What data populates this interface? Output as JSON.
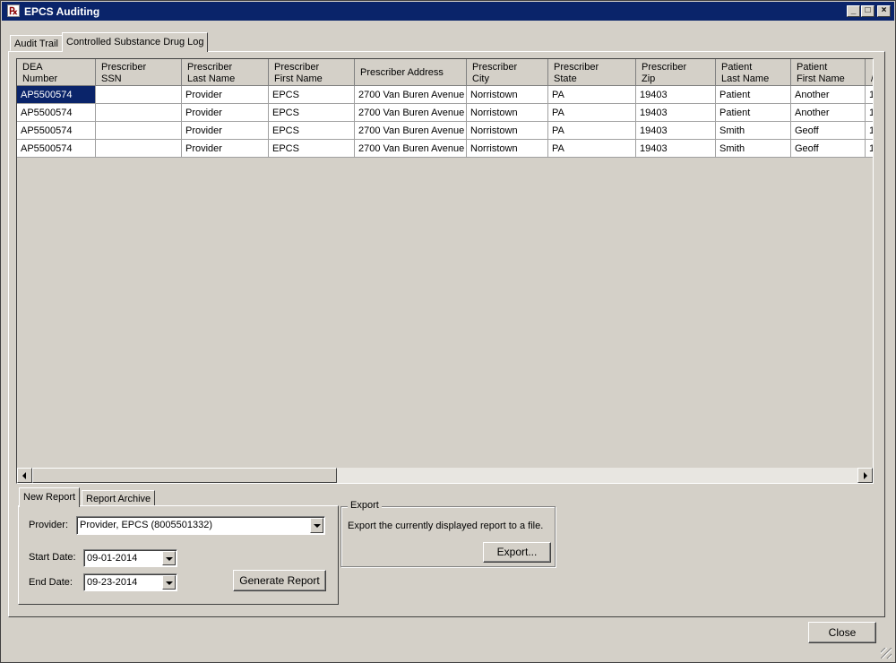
{
  "window": {
    "title": "EPCS Auditing",
    "app_icon": "prescription-icon"
  },
  "title_buttons": {
    "minimize": "_",
    "maximize": "□",
    "close": "×"
  },
  "tabs": [
    {
      "label": "Audit Trail",
      "selected": false
    },
    {
      "label": "Controlled Substance Drug Log",
      "selected": true
    }
  ],
  "table": {
    "columns": [
      "DEA\nNumber",
      "Prescriber\nSSN",
      "Prescriber\nLast Name",
      "Prescriber\nFirst Name",
      "Prescriber Address",
      "Prescriber\nCity",
      "Prescriber\nState",
      "Prescriber\nZip",
      "Patient\nLast Name",
      "Patient\nFirst Name",
      "/"
    ],
    "rows": [
      [
        "AP5500574",
        "",
        "Provider",
        "EPCS",
        "2700 Van Buren Avenue",
        "Norristown",
        "PA",
        "19403",
        "Patient",
        "Another",
        "1"
      ],
      [
        "AP5500574",
        "",
        "Provider",
        "EPCS",
        "2700 Van Buren Avenue",
        "Norristown",
        "PA",
        "19403",
        "Patient",
        "Another",
        "1"
      ],
      [
        "AP5500574",
        "",
        "Provider",
        "EPCS",
        "2700 Van Buren Avenue",
        "Norristown",
        "PA",
        "19403",
        "Smith",
        "Geoff",
        "1"
      ],
      [
        "AP5500574",
        "",
        "Provider",
        "EPCS",
        "2700 Van Buren Avenue",
        "Norristown",
        "PA",
        "19403",
        "Smith",
        "Geoff",
        "1"
      ]
    ]
  },
  "report_tabs": [
    {
      "label": "New Report",
      "selected": true
    },
    {
      "label": "Report Archive",
      "selected": false
    }
  ],
  "new_report": {
    "provider_label": "Provider:",
    "provider_value": "Provider, EPCS (8005501332)",
    "start_label": "Start Date:",
    "start_value": "09-01-2014",
    "end_label": "End Date:",
    "end_value": "09-23-2014",
    "generate_label": "Generate Report"
  },
  "export": {
    "legend": "Export",
    "description": "Export the currently displayed report to a file.",
    "button_label": "Export..."
  },
  "footer": {
    "close_label": "Close"
  }
}
